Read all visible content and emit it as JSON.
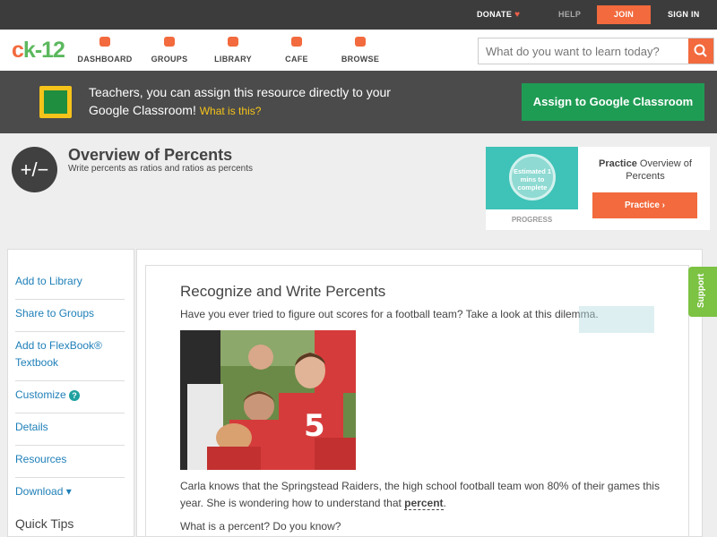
{
  "topbar": {
    "donate": "DONATE",
    "help": "HELP",
    "join": "JOIN",
    "signin": "SIGN IN"
  },
  "nav": {
    "logo_c": "c",
    "logo_k": "k",
    "logo_rest": "-12",
    "items": [
      "DASHBOARD",
      "GROUPS",
      "LIBRARY",
      "CAFE",
      "BROWSE"
    ],
    "search_placeholder": "What do you want to learn today?"
  },
  "teacher": {
    "text": "Teachers, you can assign this resource directly to your Google Classroom!",
    "link": "What is this?",
    "assign": "Assign to Google Classroom"
  },
  "concept": {
    "icon": "+/−",
    "title": "Overview of Percents",
    "subtitle": "Write percents as ratios and ratios as percents"
  },
  "practice": {
    "estimate": "Estimated 1 mins to complete",
    "progress": "PROGRESS",
    "label_bold": "Practice",
    "label_rest": " Overview of Percents",
    "button": "Practice"
  },
  "sidebar": {
    "items": [
      "Add to Library",
      "Share to Groups",
      "Add to FlexBook® Textbook",
      "Customize",
      "Details",
      "Resources",
      "Download ▾"
    ],
    "tips": "Quick Tips"
  },
  "content": {
    "title": "Recognize and Write Percents",
    "intro": "Have you ever tried to figure out scores for a football team? Take a look at this dilemma.",
    "body1_a": "Carla knows that the Springstead Raiders, the high school football team won 80% of their games this year. She is wondering how to understand that ",
    "body1_term": "percent",
    "body1_b": ".",
    "body2": "What is a percent? Do you know?"
  },
  "support": "Support"
}
